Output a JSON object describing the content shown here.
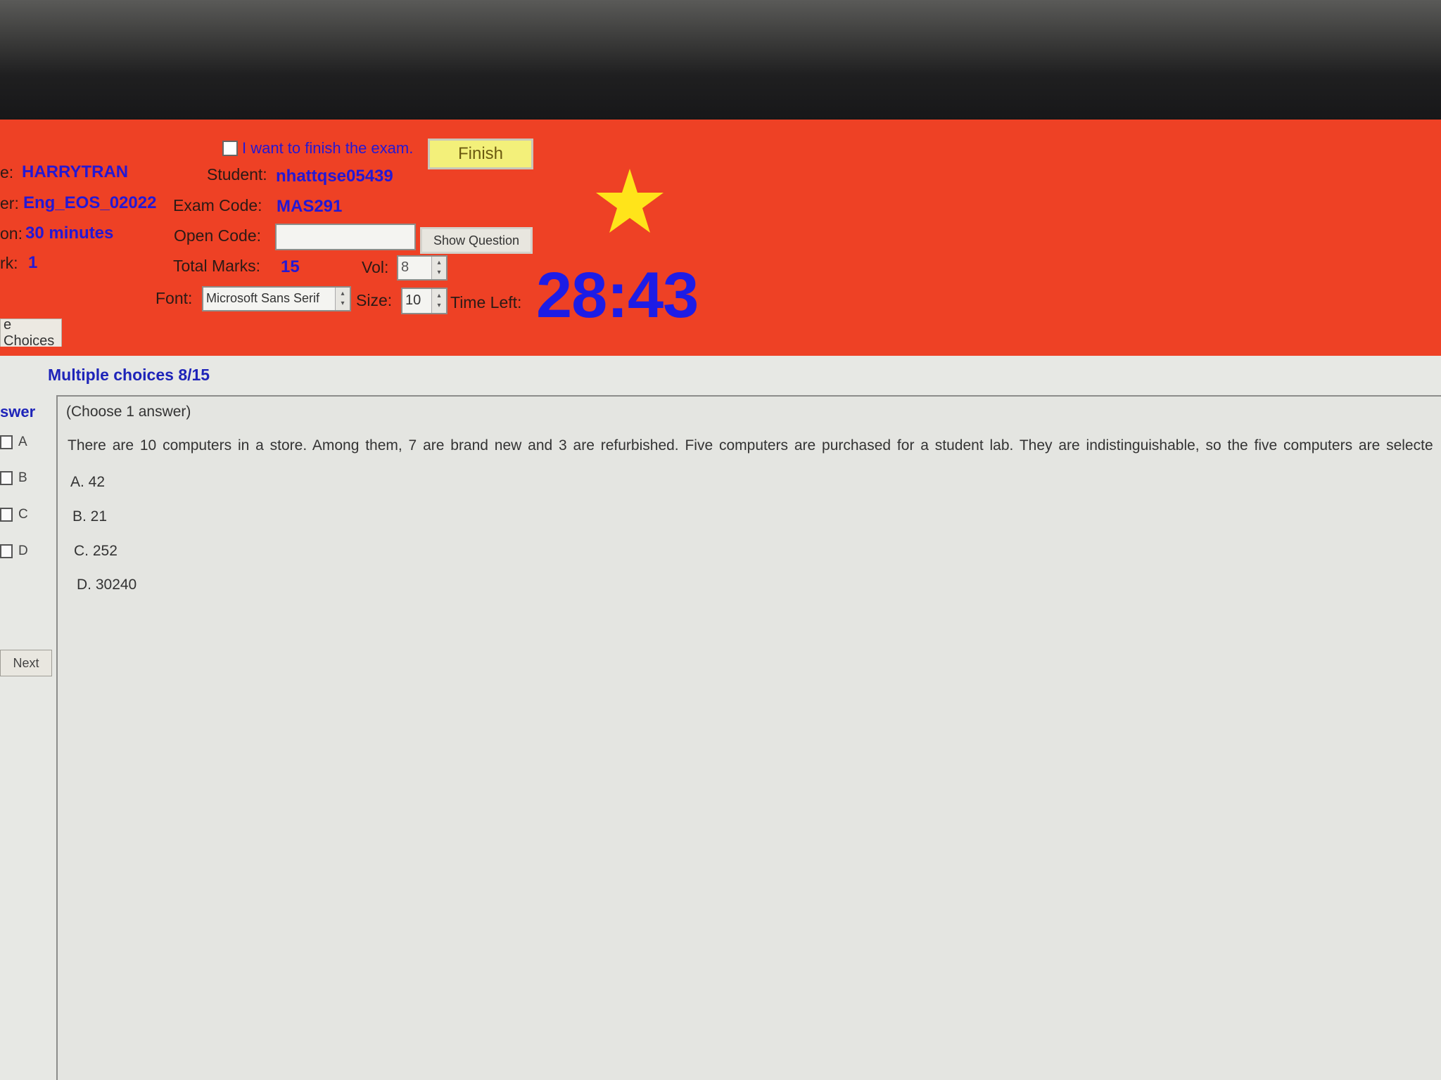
{
  "header": {
    "finish_checkbox_label": "I want to finish the exam.",
    "finish_button": "Finish",
    "show_question_button": "Show Question",
    "labels": {
      "machine_suffix": "e:",
      "server_suffix": "er:",
      "duration_suffix": "on:",
      "mark_suffix": "rk:",
      "student": "Student:",
      "exam_code": "Exam Code:",
      "open_code": "Open Code:",
      "total_marks": "Total Marks:",
      "vol": "Vol:",
      "font": "Font:",
      "size": "Size:",
      "time_left": "Time Left:"
    },
    "values": {
      "machine": "HARRYTRAN",
      "server": "Eng_EOS_02022",
      "duration": "30 minutes",
      "mark": "1",
      "student": "nhattqse05439",
      "exam_code": "MAS291",
      "open_code": "",
      "total_marks": "15",
      "vol": "8",
      "font": "Microsoft Sans Serif",
      "size": "10",
      "time_left": "28:43"
    },
    "colors": {
      "background": "#ee4125",
      "value_text": "#2418d4",
      "star": "#ffe41a"
    }
  },
  "tab": {
    "label": "e Choices"
  },
  "question": {
    "title": "Multiple choices 8/15",
    "answer_header": "swer",
    "answer_letters": [
      "A",
      "B",
      "C",
      "D"
    ],
    "hint": "(Choose 1 answer)",
    "text": "There are 10 computers in a store. Among them, 7 are brand new and 3 are refurbished. Five computers are purchased for a student lab. They are indistinguishable, so the five computers are selecte",
    "options": [
      "A. 42",
      "B. 21",
      "C. 252",
      "D. 30240"
    ],
    "next_button": "Next"
  }
}
